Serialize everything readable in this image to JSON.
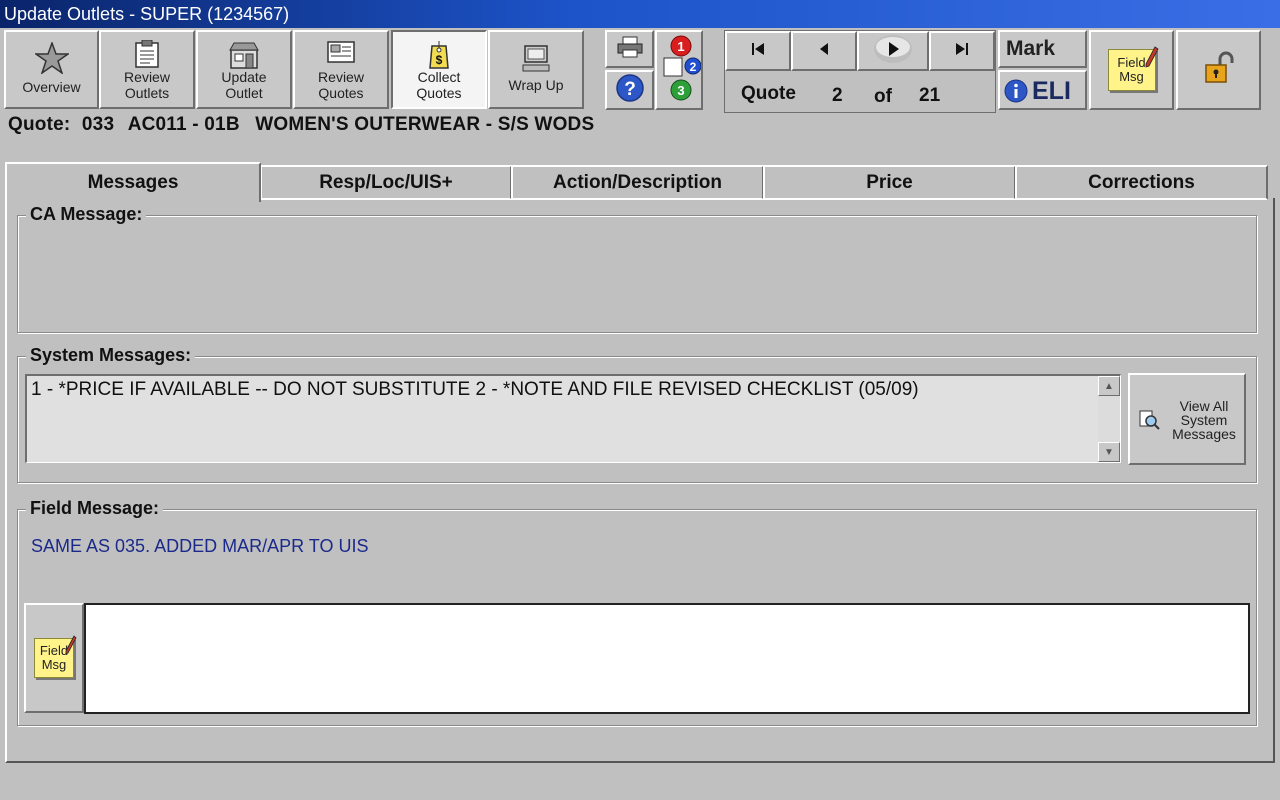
{
  "window": {
    "title": "Update Outlets -  SUPER (1234567)"
  },
  "toolbar": {
    "overview": "Overview",
    "review_outlets": [
      "Review",
      "Outlets"
    ],
    "update_outlet": [
      "Update",
      "Outlet"
    ],
    "review_quotes": [
      "Review",
      "Quotes"
    ],
    "collect_quotes": [
      "Collect",
      "Quotes"
    ],
    "wrap_up": "Wrap Up",
    "mark": "Mark",
    "eli": "ELI",
    "field_msg": [
      "Field",
      "Msg"
    ],
    "badges": [
      "1",
      "2",
      "3"
    ]
  },
  "nav": {
    "quote_label": "Quote",
    "current": "2",
    "of_label": "of",
    "total": "21"
  },
  "quote": {
    "label": "Quote:",
    "number": "033",
    "code": "AC011 - 01B",
    "description": "WOMEN'S OUTERWEAR - S/S WODS"
  },
  "tabs": [
    "Messages",
    "Resp/Loc/UIS+",
    "Action/Description",
    "Price",
    "Corrections"
  ],
  "ca_message": {
    "title": "CA Message:"
  },
  "system_messages": {
    "title": "System Messages:",
    "text": "1 - *PRICE IF AVAILABLE -- DO NOT SUBSTITUTE    2 - *NOTE AND FILE REVISED CHECKLIST (05/09)",
    "view_all": [
      "View All",
      "System",
      "Messages"
    ]
  },
  "field_message": {
    "title": "Field Message:",
    "text": "SAME AS 035. ADDED MAR/APR TO UIS",
    "input_value": "",
    "note": [
      "Field",
      "Msg"
    ]
  }
}
